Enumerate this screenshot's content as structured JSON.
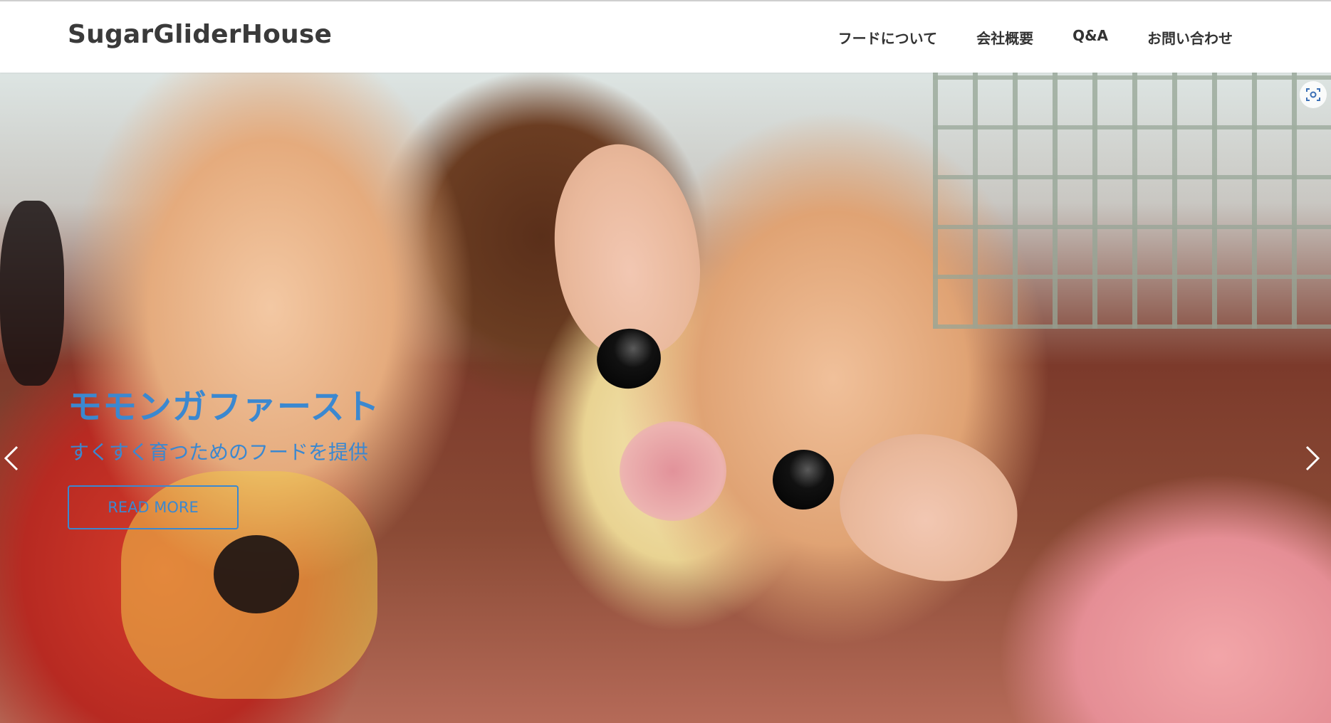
{
  "header": {
    "logo": "SugarGliderHouse",
    "nav": [
      {
        "label": "フードについて"
      },
      {
        "label": "会社概要"
      },
      {
        "label": "Q&A"
      },
      {
        "label": "お問い合わせ"
      }
    ]
  },
  "hero": {
    "title": "モモンガファースト",
    "subtitle": "すくすく育つためのフードを提供",
    "button_label": "READ MORE",
    "image_subject": "sugar glider in fluffy blanket pouch",
    "accent_color": "#3b88d0",
    "icons": {
      "prev": "chevron-left-icon",
      "next": "chevron-right-icon",
      "lens": "image-search-icon"
    }
  }
}
